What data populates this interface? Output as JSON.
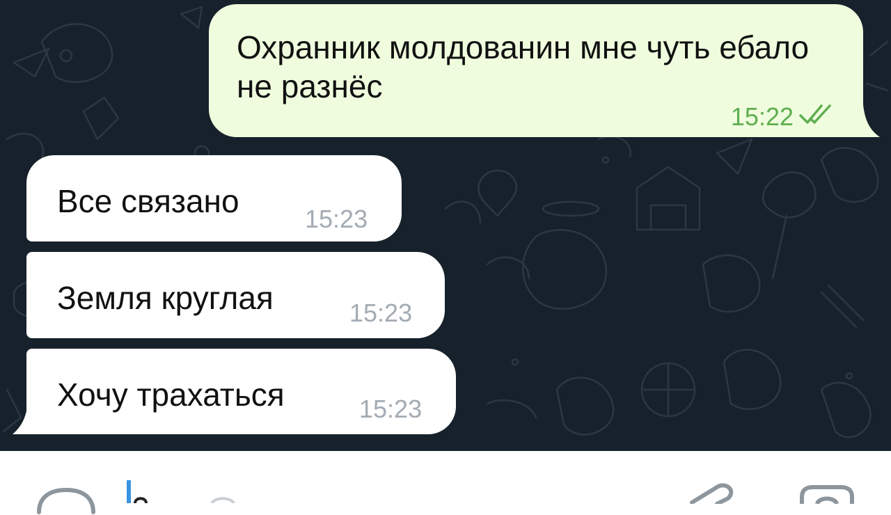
{
  "chat": {
    "background_color": "#16212b",
    "messages": [
      {
        "direction": "outgoing",
        "text": "Охранник молдованин мне чуть ебало не разнёс",
        "time": "15:22",
        "status": "read",
        "status_icon": "double-check-icon"
      },
      {
        "direction": "incoming",
        "text": "Все связано",
        "time": "15:23"
      },
      {
        "direction": "incoming",
        "text": "Земля круглая",
        "time": "15:23"
      },
      {
        "direction": "incoming",
        "text": "Хочу трахаться",
        "time": "15:23"
      }
    ],
    "colors": {
      "outgoing_bubble": "#effdde",
      "incoming_bubble": "#ffffff",
      "outgoing_time": "#5fae4f",
      "incoming_time": "#a3abb3",
      "cursor": "#3a93e0"
    }
  },
  "input_bar": {
    "left_icon": "emoji-icon",
    "right_icons": [
      "attach-icon",
      "camera-icon"
    ]
  }
}
